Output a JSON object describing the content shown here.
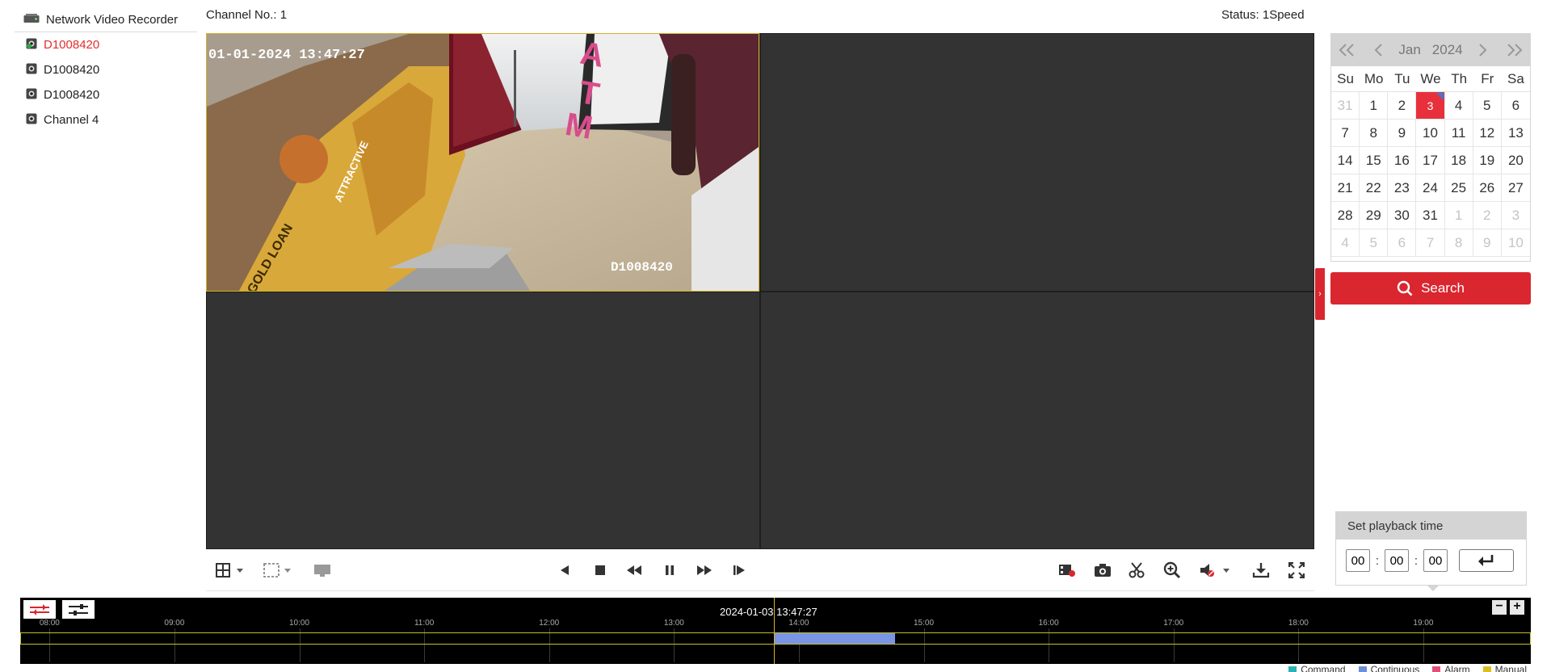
{
  "tree": {
    "root_label": "Network Video Recorder",
    "channels": [
      {
        "label": "D1008420",
        "active": true
      },
      {
        "label": "D1008420",
        "active": false
      },
      {
        "label": "D1008420",
        "active": false
      },
      {
        "label": "Channel 4",
        "active": false
      }
    ]
  },
  "info": {
    "channel": "Channel No.: 1",
    "status": "Status: 1Speed"
  },
  "video": {
    "osd_time": "01-01-2024 13:47:27",
    "osd_channel": "D1008420",
    "sign_text": "ATM",
    "poster_text_1": "ATTRACTIVE",
    "poster_text_2": "GOLD LOAN"
  },
  "calendar": {
    "month": "Jan",
    "year": "2024",
    "weekdays": [
      "Su",
      "Mo",
      "Tu",
      "We",
      "Th",
      "Fr",
      "Sa"
    ],
    "days": [
      {
        "d": "31",
        "other": true
      },
      {
        "d": "1"
      },
      {
        "d": "2"
      },
      {
        "d": "3",
        "selected": true
      },
      {
        "d": "4"
      },
      {
        "d": "5"
      },
      {
        "d": "6"
      },
      {
        "d": "7"
      },
      {
        "d": "8"
      },
      {
        "d": "9"
      },
      {
        "d": "10"
      },
      {
        "d": "11"
      },
      {
        "d": "12"
      },
      {
        "d": "13"
      },
      {
        "d": "14"
      },
      {
        "d": "15"
      },
      {
        "d": "16"
      },
      {
        "d": "17"
      },
      {
        "d": "18"
      },
      {
        "d": "19"
      },
      {
        "d": "20"
      },
      {
        "d": "21"
      },
      {
        "d": "22"
      },
      {
        "d": "23"
      },
      {
        "d": "24"
      },
      {
        "d": "25"
      },
      {
        "d": "26"
      },
      {
        "d": "27"
      },
      {
        "d": "28"
      },
      {
        "d": "29"
      },
      {
        "d": "30"
      },
      {
        "d": "31"
      },
      {
        "d": "1",
        "other": true
      },
      {
        "d": "2",
        "other": true
      },
      {
        "d": "3",
        "other": true
      },
      {
        "d": "4",
        "other": true
      },
      {
        "d": "5",
        "other": true
      },
      {
        "d": "6",
        "other": true
      },
      {
        "d": "7",
        "other": true
      },
      {
        "d": "8",
        "other": true
      },
      {
        "d": "9",
        "other": true
      },
      {
        "d": "10",
        "other": true
      }
    ]
  },
  "search": {
    "label": "Search"
  },
  "playback": {
    "title": "Set playback time",
    "hour": "00",
    "minute": "00",
    "second": "00",
    "sep": ":"
  },
  "timeline": {
    "current": "2024-01-03 13:47:27",
    "hours": [
      "08:00",
      "09:00",
      "10:00",
      "11:00",
      "12:00",
      "13:00",
      "14:00",
      "15:00",
      "16:00",
      "17:00",
      "18:00",
      "19:00"
    ],
    "record_start_hour": 13.8,
    "record_end_hour": 14.77,
    "cursor_hour": 13.8
  },
  "legend": [
    "Command",
    "Continuous",
    "Alarm",
    "Manual"
  ],
  "colors": {
    "accent": "#d9262f",
    "selected_day": "#e8303c",
    "record": "#7a95e3",
    "legend": [
      "#2bb3b3",
      "#6d8fd6",
      "#e0507a",
      "#d8c021"
    ]
  }
}
